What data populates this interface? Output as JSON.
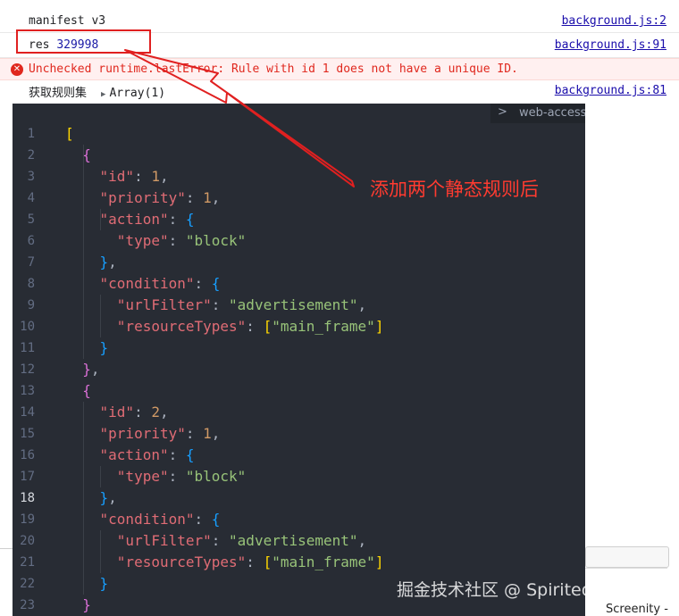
{
  "console": {
    "rows": [
      {
        "message": "manifest v3",
        "source": "background.js:2"
      },
      {
        "label": "res",
        "value": "329998",
        "source": "background.js:91"
      },
      {
        "message": "Unchecked runtime.lastError: Rule with id 1 does not have a unique ID.",
        "level": "error"
      },
      {
        "label": "获取规则集",
        "expander": "Array(1)",
        "source": "background.js:81"
      }
    ],
    "error_icon": "x-circle-icon"
  },
  "editor": {
    "tab_label": "web-access",
    "tab_icon": "chevron-right-icon",
    "active_line": 18,
    "lines": [
      {
        "n": 1
      },
      {
        "n": 2
      },
      {
        "n": 3
      },
      {
        "n": 4
      },
      {
        "n": 5
      },
      {
        "n": 6
      },
      {
        "n": 7
      },
      {
        "n": 8
      },
      {
        "n": 9
      },
      {
        "n": 10
      },
      {
        "n": 11
      },
      {
        "n": 12
      },
      {
        "n": 13
      },
      {
        "n": 14
      },
      {
        "n": 15
      },
      {
        "n": 16
      },
      {
        "n": 17
      },
      {
        "n": 18
      },
      {
        "n": 19
      },
      {
        "n": 20
      },
      {
        "n": 21
      },
      {
        "n": 22
      },
      {
        "n": 23
      }
    ],
    "rules": [
      {
        "id": 1,
        "priority": 1,
        "action_type": "block",
        "urlFilter": "advertisement",
        "resourceTypes": [
          "main_frame"
        ]
      },
      {
        "id": 2,
        "priority": 1,
        "action_type": "block",
        "urlFilter": "advertisement",
        "resourceTypes": [
          "main_frame"
        ]
      }
    ],
    "keys": {
      "id": "\"id\"",
      "priority": "\"priority\"",
      "action": "\"action\"",
      "type": "\"type\"",
      "condition": "\"condition\"",
      "urlFilter": "\"urlFilter\"",
      "resourceTypes": "\"resourceTypes\""
    }
  },
  "annotation": {
    "text": "添加两个静态规则后",
    "color": "#ff3b30"
  },
  "watermark": "掘金技术社区 @ Spirited_Away",
  "taskbar": {
    "app_label": "Screenity -"
  }
}
